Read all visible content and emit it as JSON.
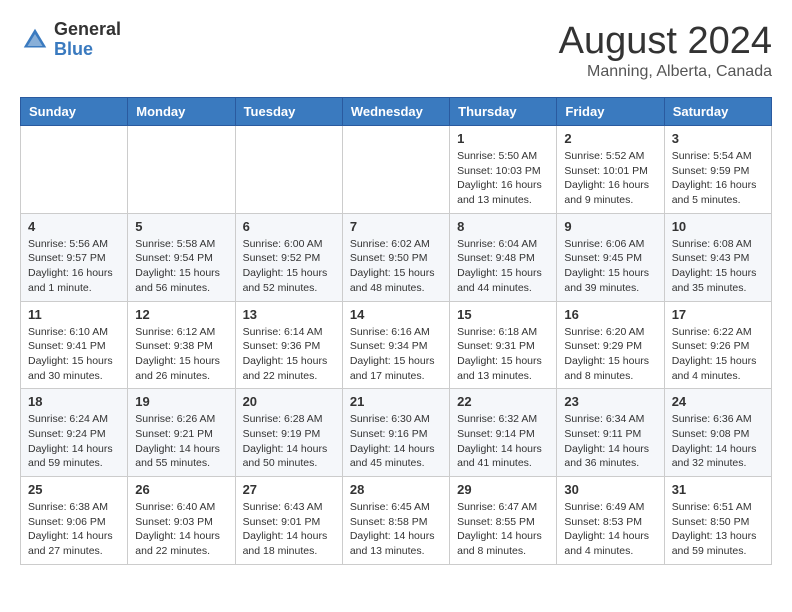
{
  "header": {
    "logo_general": "General",
    "logo_blue": "Blue",
    "main_title": "August 2024",
    "subtitle": "Manning, Alberta, Canada"
  },
  "calendar": {
    "days_of_week": [
      "Sunday",
      "Monday",
      "Tuesday",
      "Wednesday",
      "Thursday",
      "Friday",
      "Saturday"
    ],
    "weeks": [
      [
        {
          "day": "",
          "info": ""
        },
        {
          "day": "",
          "info": ""
        },
        {
          "day": "",
          "info": ""
        },
        {
          "day": "",
          "info": ""
        },
        {
          "day": "1",
          "info": "Sunrise: 5:50 AM\nSunset: 10:03 PM\nDaylight: 16 hours\nand 13 minutes."
        },
        {
          "day": "2",
          "info": "Sunrise: 5:52 AM\nSunset: 10:01 PM\nDaylight: 16 hours\nand 9 minutes."
        },
        {
          "day": "3",
          "info": "Sunrise: 5:54 AM\nSunset: 9:59 PM\nDaylight: 16 hours\nand 5 minutes."
        }
      ],
      [
        {
          "day": "4",
          "info": "Sunrise: 5:56 AM\nSunset: 9:57 PM\nDaylight: 16 hours\nand 1 minute."
        },
        {
          "day": "5",
          "info": "Sunrise: 5:58 AM\nSunset: 9:54 PM\nDaylight: 15 hours\nand 56 minutes."
        },
        {
          "day": "6",
          "info": "Sunrise: 6:00 AM\nSunset: 9:52 PM\nDaylight: 15 hours\nand 52 minutes."
        },
        {
          "day": "7",
          "info": "Sunrise: 6:02 AM\nSunset: 9:50 PM\nDaylight: 15 hours\nand 48 minutes."
        },
        {
          "day": "8",
          "info": "Sunrise: 6:04 AM\nSunset: 9:48 PM\nDaylight: 15 hours\nand 44 minutes."
        },
        {
          "day": "9",
          "info": "Sunrise: 6:06 AM\nSunset: 9:45 PM\nDaylight: 15 hours\nand 39 minutes."
        },
        {
          "day": "10",
          "info": "Sunrise: 6:08 AM\nSunset: 9:43 PM\nDaylight: 15 hours\nand 35 minutes."
        }
      ],
      [
        {
          "day": "11",
          "info": "Sunrise: 6:10 AM\nSunset: 9:41 PM\nDaylight: 15 hours\nand 30 minutes."
        },
        {
          "day": "12",
          "info": "Sunrise: 6:12 AM\nSunset: 9:38 PM\nDaylight: 15 hours\nand 26 minutes."
        },
        {
          "day": "13",
          "info": "Sunrise: 6:14 AM\nSunset: 9:36 PM\nDaylight: 15 hours\nand 22 minutes."
        },
        {
          "day": "14",
          "info": "Sunrise: 6:16 AM\nSunset: 9:34 PM\nDaylight: 15 hours\nand 17 minutes."
        },
        {
          "day": "15",
          "info": "Sunrise: 6:18 AM\nSunset: 9:31 PM\nDaylight: 15 hours\nand 13 minutes."
        },
        {
          "day": "16",
          "info": "Sunrise: 6:20 AM\nSunset: 9:29 PM\nDaylight: 15 hours\nand 8 minutes."
        },
        {
          "day": "17",
          "info": "Sunrise: 6:22 AM\nSunset: 9:26 PM\nDaylight: 15 hours\nand 4 minutes."
        }
      ],
      [
        {
          "day": "18",
          "info": "Sunrise: 6:24 AM\nSunset: 9:24 PM\nDaylight: 14 hours\nand 59 minutes."
        },
        {
          "day": "19",
          "info": "Sunrise: 6:26 AM\nSunset: 9:21 PM\nDaylight: 14 hours\nand 55 minutes."
        },
        {
          "day": "20",
          "info": "Sunrise: 6:28 AM\nSunset: 9:19 PM\nDaylight: 14 hours\nand 50 minutes."
        },
        {
          "day": "21",
          "info": "Sunrise: 6:30 AM\nSunset: 9:16 PM\nDaylight: 14 hours\nand 45 minutes."
        },
        {
          "day": "22",
          "info": "Sunrise: 6:32 AM\nSunset: 9:14 PM\nDaylight: 14 hours\nand 41 minutes."
        },
        {
          "day": "23",
          "info": "Sunrise: 6:34 AM\nSunset: 9:11 PM\nDaylight: 14 hours\nand 36 minutes."
        },
        {
          "day": "24",
          "info": "Sunrise: 6:36 AM\nSunset: 9:08 PM\nDaylight: 14 hours\nand 32 minutes."
        }
      ],
      [
        {
          "day": "25",
          "info": "Sunrise: 6:38 AM\nSunset: 9:06 PM\nDaylight: 14 hours\nand 27 minutes."
        },
        {
          "day": "26",
          "info": "Sunrise: 6:40 AM\nSunset: 9:03 PM\nDaylight: 14 hours\nand 22 minutes."
        },
        {
          "day": "27",
          "info": "Sunrise: 6:43 AM\nSunset: 9:01 PM\nDaylight: 14 hours\nand 18 minutes."
        },
        {
          "day": "28",
          "info": "Sunrise: 6:45 AM\nSunset: 8:58 PM\nDaylight: 14 hours\nand 13 minutes."
        },
        {
          "day": "29",
          "info": "Sunrise: 6:47 AM\nSunset: 8:55 PM\nDaylight: 14 hours\nand 8 minutes."
        },
        {
          "day": "30",
          "info": "Sunrise: 6:49 AM\nSunset: 8:53 PM\nDaylight: 14 hours\nand 4 minutes."
        },
        {
          "day": "31",
          "info": "Sunrise: 6:51 AM\nSunset: 8:50 PM\nDaylight: 13 hours\nand 59 minutes."
        }
      ]
    ]
  }
}
